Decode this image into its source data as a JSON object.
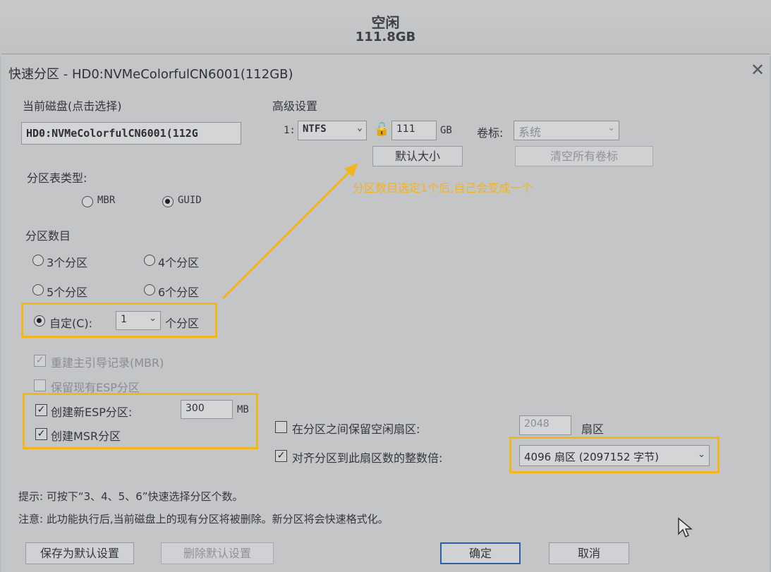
{
  "background": {
    "title": "空闲",
    "size": "111.8GB"
  },
  "dialog": {
    "title": "快速分区 - HD0:NVMeColorfulCN6001(112GB)",
    "close_symbol": "✕"
  },
  "disk": {
    "label": "当前磁盘(点击选择)",
    "value": "HD0:NVMeColorfulCN6001(112G"
  },
  "table_type": {
    "label": "分区表类型:",
    "options": [
      "MBR",
      "GUID"
    ],
    "selected": "GUID"
  },
  "partition_count": {
    "label": "分区数目",
    "options": [
      "3个分区",
      "4个分区",
      "5个分区",
      "6个分区"
    ],
    "custom_label": "自定(C):",
    "custom_value": "1",
    "custom_suffix": "个分区"
  },
  "checkboxes": {
    "rebuild_mbr": "重建主引导记录(MBR)",
    "keep_esp": "保留现有ESP分区",
    "create_esp": "创建新ESP分区:",
    "esp_size": "300",
    "esp_unit": "MB",
    "create_msr": "创建MSR分区"
  },
  "advanced": {
    "label": "高级设置",
    "row_index": "1:",
    "fs": "NTFS",
    "size": "111",
    "size_unit": "GB",
    "volume_label_caption": "卷标:",
    "volume_label_value": "系统",
    "default_size_button": "默认大小",
    "clear_labels_button": "清空所有卷标"
  },
  "annotation": {
    "text": "分区数目选定1个后,自己会变成一个",
    "color": "#f5b31c"
  },
  "sectors": {
    "keep_free_label": "在分区之间保留空闲扇区:",
    "keep_free_value": "2048",
    "keep_free_unit": "扇区",
    "align_label": "对齐分区到此扇区数的整数倍:",
    "align_value": "4096 扇区 (2097152 字节)"
  },
  "notes": {
    "tip": "提示: 可按下“3、4、5、6”快速选择分区个数。",
    "warning": "注意: 此功能执行后,当前磁盘上的现有分区将被删除。新分区将会快速格式化。"
  },
  "buttons": {
    "save_default": "保存为默认设置",
    "delete_default": "删除默认设置",
    "ok": "确定",
    "cancel": "取消"
  }
}
